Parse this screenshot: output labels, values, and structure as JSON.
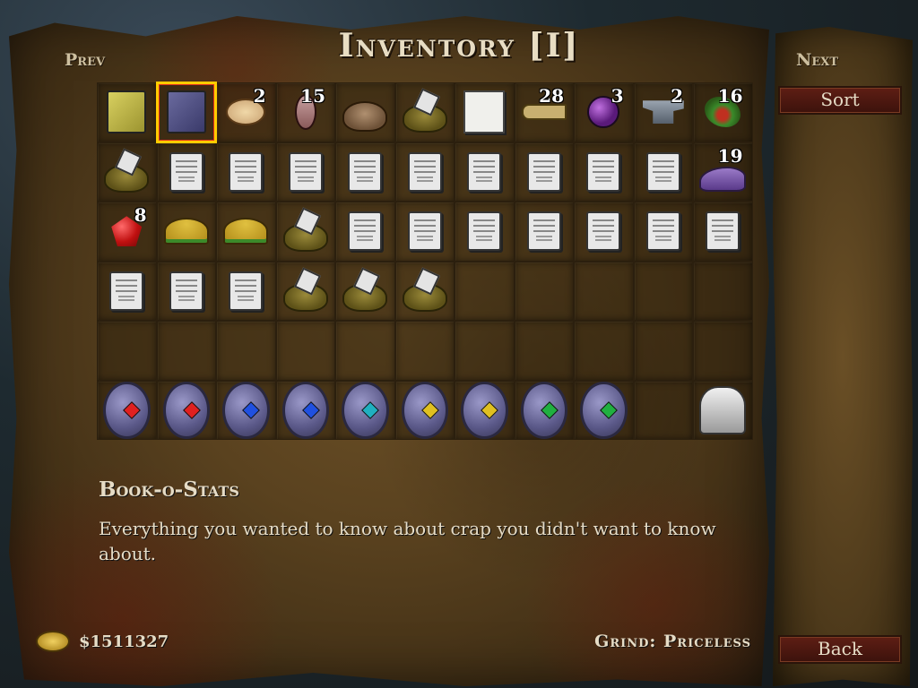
{
  "title": "Inventory [I]",
  "nav": {
    "prev": "Prev",
    "next": "Next"
  },
  "buttons": {
    "sort": "Sort",
    "back": "Back"
  },
  "grid": {
    "columns": 11,
    "rows": [
      [
        {
          "item": "yellow-book-icon",
          "count": ""
        },
        {
          "item": "book-o-stats-icon",
          "count": "",
          "selected": true
        },
        {
          "item": "fortune-cookie-icon",
          "count": "2"
        },
        {
          "item": "leaf-icon",
          "count": "15"
        },
        {
          "item": "poop-icon",
          "count": ""
        },
        {
          "item": "poop-note-icon",
          "count": ""
        },
        {
          "item": "paper-icon",
          "count": ""
        },
        {
          "item": "key-icon",
          "count": "28"
        },
        {
          "item": "potion-icon",
          "count": "3"
        },
        {
          "item": "anvil-icon",
          "count": "2"
        },
        {
          "item": "herb-icon",
          "count": "16"
        }
      ],
      [
        {
          "item": "poop-note-icon",
          "count": ""
        },
        {
          "item": "note-icon",
          "count": ""
        },
        {
          "item": "note-icon",
          "count": ""
        },
        {
          "item": "note-icon",
          "count": ""
        },
        {
          "item": "note-icon",
          "count": ""
        },
        {
          "item": "note-icon",
          "count": ""
        },
        {
          "item": "note-icon",
          "count": ""
        },
        {
          "item": "note-icon",
          "count": ""
        },
        {
          "item": "note-icon",
          "count": ""
        },
        {
          "item": "note-icon",
          "count": ""
        },
        {
          "item": "shoe-icon",
          "count": "19"
        }
      ],
      [
        {
          "item": "ruby-icon",
          "count": "8"
        },
        {
          "item": "taco-icon",
          "count": ""
        },
        {
          "item": "taco-icon",
          "count": ""
        },
        {
          "item": "poop-note-icon",
          "count": ""
        },
        {
          "item": "note-icon",
          "count": ""
        },
        {
          "item": "note-icon",
          "count": ""
        },
        {
          "item": "note-icon",
          "count": ""
        },
        {
          "item": "note-icon",
          "count": ""
        },
        {
          "item": "note-icon",
          "count": ""
        },
        {
          "item": "note-icon",
          "count": ""
        },
        {
          "item": "note-icon",
          "count": ""
        }
      ],
      [
        {
          "item": "note-icon",
          "count": ""
        },
        {
          "item": "note-icon",
          "count": ""
        },
        {
          "item": "note-icon",
          "count": ""
        },
        {
          "item": "poop-note-icon",
          "count": ""
        },
        {
          "item": "poop-note-icon",
          "count": ""
        },
        {
          "item": "poop-note-icon",
          "count": ""
        },
        {
          "item": "",
          "count": ""
        },
        {
          "item": "",
          "count": ""
        },
        {
          "item": "",
          "count": ""
        },
        {
          "item": "",
          "count": ""
        },
        {
          "item": "",
          "count": ""
        }
      ],
      [
        {
          "item": "",
          "count": ""
        },
        {
          "item": "",
          "count": ""
        },
        {
          "item": "",
          "count": ""
        },
        {
          "item": "",
          "count": ""
        },
        {
          "item": "",
          "count": ""
        },
        {
          "item": "",
          "count": ""
        },
        {
          "item": "",
          "count": ""
        },
        {
          "item": "",
          "count": ""
        },
        {
          "item": "",
          "count": ""
        },
        {
          "item": "",
          "count": ""
        },
        {
          "item": "",
          "count": ""
        }
      ],
      [
        {
          "item": "rune-red-icon",
          "count": ""
        },
        {
          "item": "rune-red-icon",
          "count": ""
        },
        {
          "item": "rune-blue-icon",
          "count": ""
        },
        {
          "item": "rune-blue-icon",
          "count": ""
        },
        {
          "item": "rune-teal-icon",
          "count": ""
        },
        {
          "item": "rune-yellow-icon",
          "count": ""
        },
        {
          "item": "rune-yellow-icon",
          "count": ""
        },
        {
          "item": "rune-green-icon",
          "count": ""
        },
        {
          "item": "rune-green-icon",
          "count": ""
        },
        {
          "item": "",
          "count": ""
        },
        {
          "item": "meat-grinder-icon",
          "count": ""
        }
      ]
    ]
  },
  "description": {
    "title": "Book-o-Stats",
    "text": "Everything you wanted to know about crap you didn't want to know about."
  },
  "money": {
    "icon": "coin-icon",
    "amount": "$1511327"
  },
  "grind": "Grind: Priceless",
  "colors": {
    "selection_outline": "#ffcc00",
    "button_bg": "#5e1e14",
    "text": "#e6dcc6"
  }
}
